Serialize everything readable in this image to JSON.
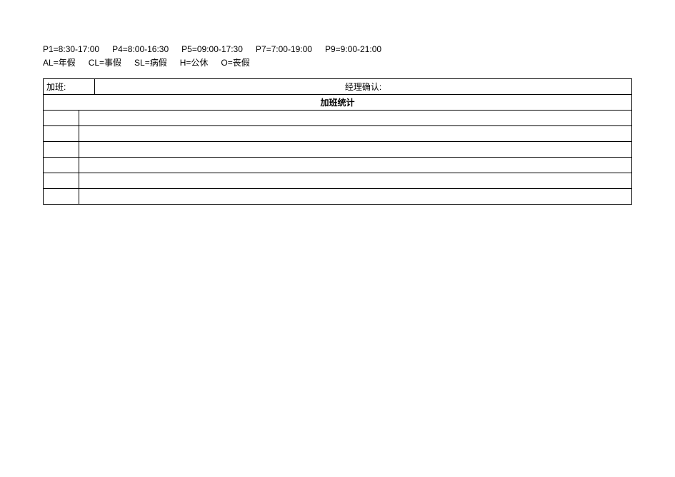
{
  "legend": {
    "shifts": [
      "P1=8:30-17:00",
      "P4=8:00-16:30",
      "P5=09:00-17:30",
      "P7=7:00-19:00",
      "P9=9:00-21:00"
    ],
    "leave_types": [
      "AL=年假",
      "CL=事假",
      "SL=病假",
      "H=公休",
      "O=丧假"
    ]
  },
  "header_row": {
    "overtime_label": "加班:",
    "manager_confirm_label": "经理确认:"
  },
  "section_title": "加班统计",
  "rows": [
    {
      "col1": "",
      "col2": ""
    },
    {
      "col1": "",
      "col2": ""
    },
    {
      "col1": "",
      "col2": ""
    },
    {
      "col1": "",
      "col2": ""
    },
    {
      "col1": "",
      "col2": ""
    },
    {
      "col1": "",
      "col2": ""
    }
  ]
}
